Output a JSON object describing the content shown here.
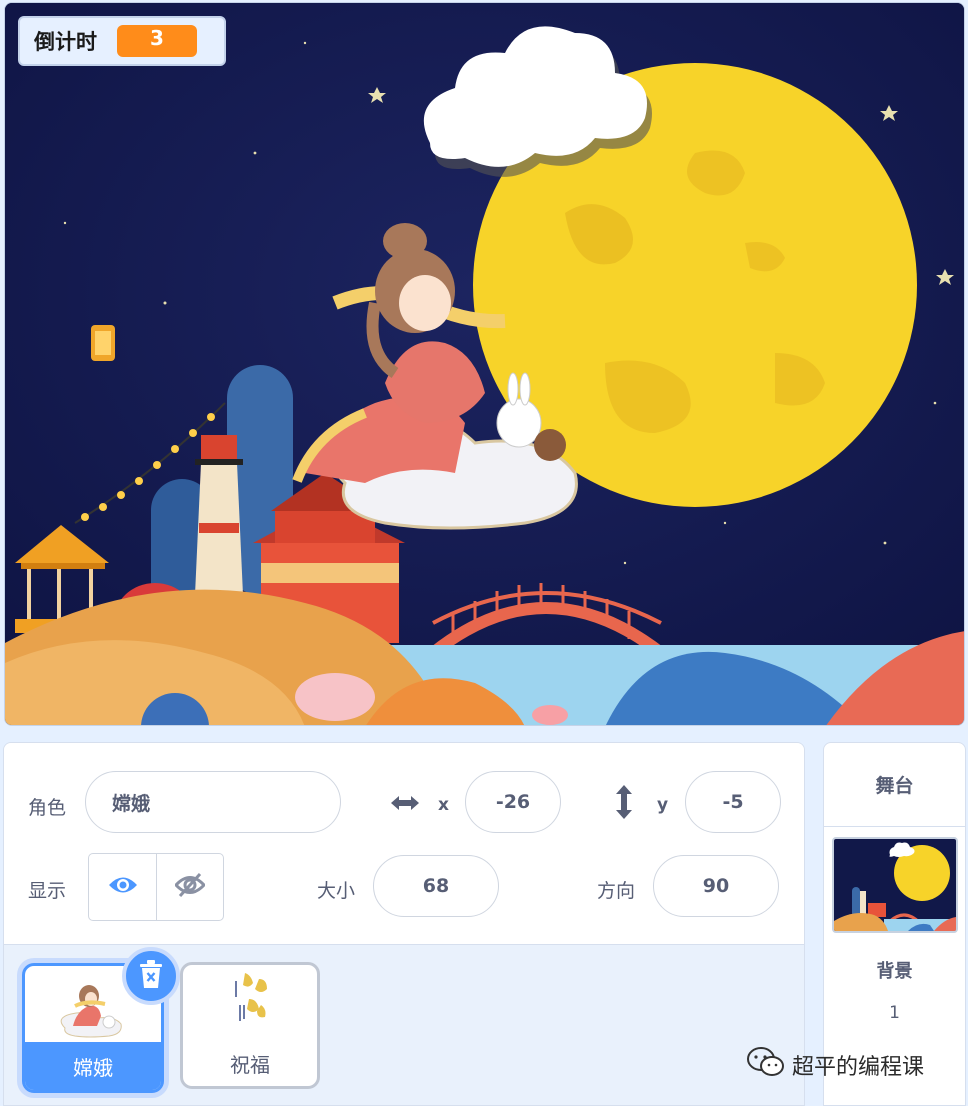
{
  "stage": {
    "monitor": {
      "label": "倒计时",
      "value": "3"
    }
  },
  "sprite_info": {
    "sprite_label": "角色",
    "sprite_name": "嫦娥",
    "x_label": "x",
    "x_value": "-26",
    "y_label": "y",
    "y_value": "-5",
    "show_label": "显示",
    "size_label": "大小",
    "size_value": "68",
    "direction_label": "方向",
    "direction_value": "90"
  },
  "sprites": [
    {
      "name": "嫦娥",
      "selected": true
    },
    {
      "name": "祝福",
      "selected": false
    }
  ],
  "stage_selector": {
    "title": "舞台",
    "backdrops_label": "背景",
    "backdrops_count": "1"
  },
  "watermark": {
    "text": "超平的编程课"
  },
  "colors": {
    "accent": "#4c97ff",
    "monitor_value": "#ff8c1a",
    "moon": "#f9d52a",
    "sky": "#0f1646"
  }
}
